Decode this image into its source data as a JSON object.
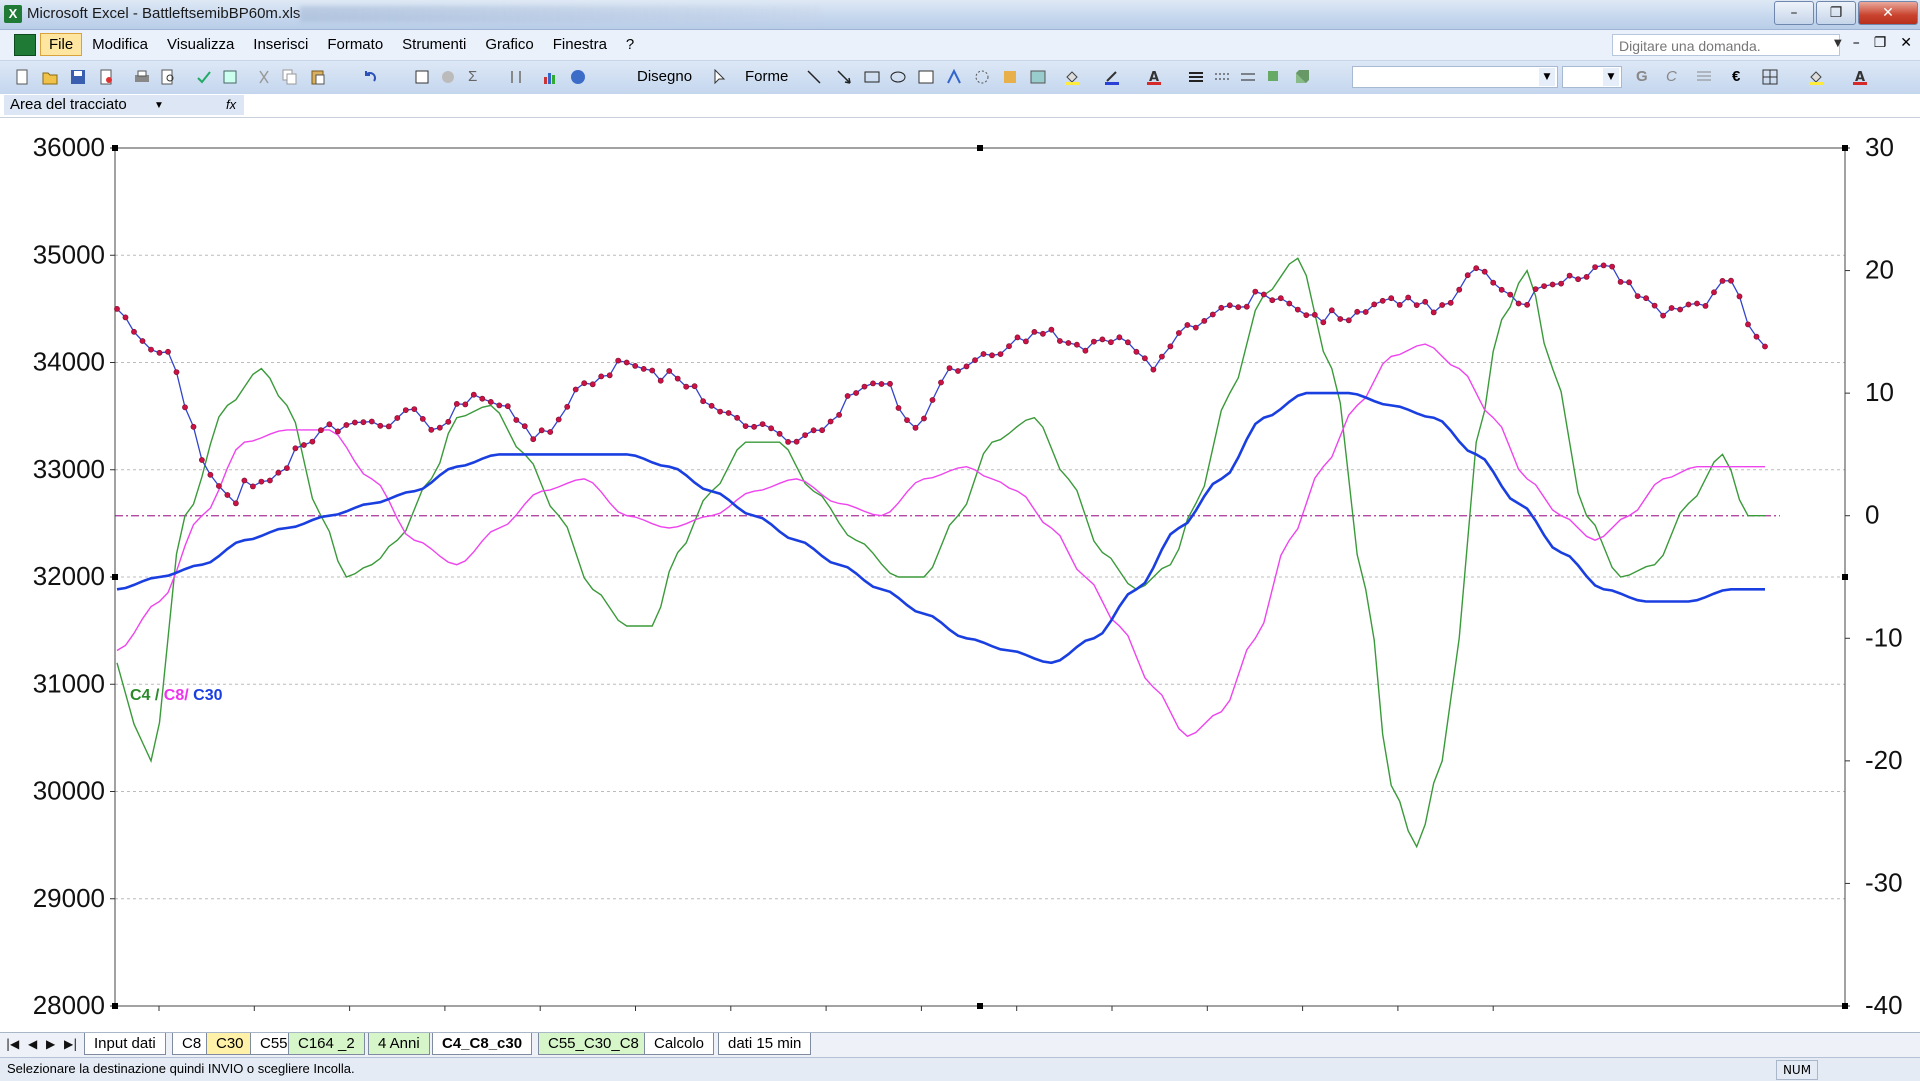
{
  "window": {
    "title": "Microsoft Excel - BattleftsemibBP60m.xls",
    "minimize": "–",
    "restore": "❐",
    "close": "✕"
  },
  "menu": {
    "items": [
      "File",
      "Modifica",
      "Visualizza",
      "Inserisci",
      "Formato",
      "Strumenti",
      "Grafico",
      "Finestra",
      "?"
    ],
    "ask_placeholder": "Digitare una domanda."
  },
  "toolbar": {
    "disegno_label": "Disegno",
    "forme_label": "Forme"
  },
  "namebox": {
    "value": "Area del tracciato",
    "fx": "fx"
  },
  "chart_data": {
    "type": "line",
    "y_left": {
      "range": [
        28000,
        36000
      ],
      "ticks": [
        "36000",
        "35000",
        "34000",
        "33000",
        "32000",
        "31000",
        "30000",
        "29000",
        "28000"
      ]
    },
    "y_right": {
      "range": [
        -40,
        30
      ],
      "ticks": [
        "30",
        "20",
        "10",
        "0",
        "-10",
        "-20",
        "-30",
        "-40"
      ]
    },
    "grid": "horizontal dashed",
    "zero_line": "dash-dot magenta at right-axis 0",
    "legend_label": {
      "c4": "C4",
      "sep1": " / ",
      "c8": "C8/",
      "c30": " C30"
    },
    "colors": {
      "price": "#cc1144",
      "price_line": "#3344cc",
      "c4": "#3a9a3a",
      "c8": "#ee44ee",
      "c30": "#1a3fe0"
    },
    "n_points": 195,
    "series": [
      {
        "name": "Price",
        "axis": "left",
        "keypoints": [
          [
            0,
            34500
          ],
          [
            3,
            34200
          ],
          [
            6,
            34100
          ],
          [
            9,
            33400
          ],
          [
            11,
            32900
          ],
          [
            14,
            32700
          ],
          [
            15,
            32900
          ],
          [
            17,
            32850
          ],
          [
            19,
            32950
          ],
          [
            21,
            33200
          ],
          [
            25,
            33400
          ],
          [
            30,
            33450
          ],
          [
            35,
            33500
          ],
          [
            38,
            33400
          ],
          [
            42,
            33700
          ],
          [
            45,
            33600
          ],
          [
            50,
            33300
          ],
          [
            55,
            33800
          ],
          [
            60,
            34000
          ],
          [
            66,
            33850
          ],
          [
            70,
            33600
          ],
          [
            75,
            33400
          ],
          [
            80,
            33300
          ],
          [
            84,
            33450
          ],
          [
            86,
            33700
          ],
          [
            90,
            33800
          ],
          [
            94,
            33400
          ],
          [
            98,
            33900
          ],
          [
            103,
            34100
          ],
          [
            109,
            34300
          ],
          [
            113,
            34100
          ],
          [
            118,
            34200
          ],
          [
            122,
            34000
          ],
          [
            126,
            34350
          ],
          [
            131,
            34500
          ],
          [
            136,
            34650
          ],
          [
            140,
            34450
          ],
          [
            145,
            34400
          ],
          [
            150,
            34600
          ],
          [
            155,
            34500
          ],
          [
            160,
            34850
          ],
          [
            165,
            34550
          ],
          [
            170,
            34800
          ],
          [
            175,
            34900
          ],
          [
            178,
            34700
          ],
          [
            182,
            34500
          ],
          [
            186,
            34550
          ],
          [
            190,
            34800
          ],
          [
            193,
            34200
          ]
        ]
      },
      {
        "name": "C4",
        "axis": "right",
        "keypoints": [
          [
            0,
            -12
          ],
          [
            2,
            -17
          ],
          [
            4,
            -20
          ],
          [
            8,
            0
          ],
          [
            13,
            9
          ],
          [
            17,
            12
          ],
          [
            20,
            9
          ],
          [
            24,
            0
          ],
          [
            27,
            -5
          ],
          [
            30,
            -4
          ],
          [
            33,
            -2
          ],
          [
            37,
            3
          ],
          [
            40,
            8
          ],
          [
            44,
            9
          ],
          [
            48,
            5
          ],
          [
            52,
            0
          ],
          [
            56,
            -6
          ],
          [
            60,
            -9
          ],
          [
            63,
            -9
          ],
          [
            66,
            -3
          ],
          [
            70,
            2
          ],
          [
            74,
            6
          ],
          [
            78,
            6
          ],
          [
            82,
            2
          ],
          [
            87,
            -2
          ],
          [
            92,
            -5
          ],
          [
            95,
            -5
          ],
          [
            99,
            0
          ],
          [
            103,
            6
          ],
          [
            108,
            8
          ],
          [
            112,
            3
          ],
          [
            116,
            -3
          ],
          [
            120,
            -6
          ],
          [
            124,
            -4
          ],
          [
            127,
            1
          ],
          [
            131,
            10
          ],
          [
            135,
            18
          ],
          [
            139,
            21
          ],
          [
            143,
            12
          ],
          [
            147,
            -6
          ],
          [
            150,
            -22
          ],
          [
            153,
            -27
          ],
          [
            156,
            -20
          ],
          [
            158,
            -10
          ],
          [
            160,
            6
          ],
          [
            163,
            16
          ],
          [
            166,
            20
          ],
          [
            169,
            12
          ],
          [
            173,
            0
          ],
          [
            177,
            -5
          ],
          [
            181,
            -4
          ],
          [
            185,
            1
          ],
          [
            189,
            5
          ],
          [
            192,
            0
          ]
        ]
      },
      {
        "name": "C8",
        "axis": "right",
        "keypoints": [
          [
            0,
            -11
          ],
          [
            5,
            -7
          ],
          [
            10,
            0
          ],
          [
            15,
            6
          ],
          [
            20,
            7
          ],
          [
            25,
            7
          ],
          [
            30,
            3
          ],
          [
            35,
            -2
          ],
          [
            40,
            -4
          ],
          [
            45,
            -1
          ],
          [
            50,
            2
          ],
          [
            55,
            3
          ],
          [
            60,
            0
          ],
          [
            65,
            -1
          ],
          [
            70,
            0
          ],
          [
            75,
            2
          ],
          [
            80,
            3
          ],
          [
            85,
            1
          ],
          [
            90,
            0
          ],
          [
            95,
            3
          ],
          [
            100,
            4
          ],
          [
            103,
            3
          ],
          [
            106,
            2
          ],
          [
            110,
            -1
          ],
          [
            114,
            -5
          ],
          [
            118,
            -9
          ],
          [
            122,
            -14
          ],
          [
            126,
            -18
          ],
          [
            130,
            -16
          ],
          [
            134,
            -10
          ],
          [
            138,
            -2
          ],
          [
            142,
            4
          ],
          [
            146,
            9
          ],
          [
            150,
            13
          ],
          [
            154,
            14
          ],
          [
            158,
            12
          ],
          [
            162,
            8
          ],
          [
            166,
            3
          ],
          [
            170,
            0
          ],
          [
            174,
            -2
          ],
          [
            178,
            0
          ],
          [
            182,
            3
          ],
          [
            186,
            4
          ],
          [
            190,
            4
          ],
          [
            193,
            4
          ]
        ]
      },
      {
        "name": "C30",
        "axis": "right",
        "keypoints": [
          [
            0,
            -6
          ],
          [
            5,
            -5
          ],
          [
            10,
            -4
          ],
          [
            15,
            -2
          ],
          [
            20,
            -1
          ],
          [
            25,
            0
          ],
          [
            30,
            1
          ],
          [
            35,
            2
          ],
          [
            40,
            4
          ],
          [
            45,
            5
          ],
          [
            50,
            5
          ],
          [
            55,
            5
          ],
          [
            60,
            5
          ],
          [
            65,
            4
          ],
          [
            70,
            2
          ],
          [
            75,
            0
          ],
          [
            80,
            -2
          ],
          [
            85,
            -4
          ],
          [
            90,
            -6
          ],
          [
            95,
            -8
          ],
          [
            100,
            -10
          ],
          [
            105,
            -11
          ],
          [
            110,
            -12
          ],
          [
            115,
            -10
          ],
          [
            120,
            -6
          ],
          [
            125,
            -1
          ],
          [
            130,
            3
          ],
          [
            135,
            8
          ],
          [
            140,
            10
          ],
          [
            145,
            10
          ],
          [
            150,
            9
          ],
          [
            155,
            8
          ],
          [
            160,
            5
          ],
          [
            165,
            1
          ],
          [
            170,
            -3
          ],
          [
            175,
            -6
          ],
          [
            180,
            -7
          ],
          [
            185,
            -7
          ],
          [
            190,
            -6
          ],
          [
            193,
            -6
          ]
        ]
      }
    ]
  },
  "tabs": [
    {
      "label": "Input dati",
      "style": "plain"
    },
    {
      "label": "C8",
      "style": "plain"
    },
    {
      "label": "C30",
      "style": "yellow"
    },
    {
      "label": "C55",
      "style": "plain"
    },
    {
      "label": "C164 _2",
      "style": "green"
    },
    {
      "label": "4 Anni",
      "style": "green"
    },
    {
      "label": "C4_C8_c30",
      "style": "active"
    },
    {
      "label": "C55_C30_C8",
      "style": "green"
    },
    {
      "label": "Calcolo",
      "style": "plain"
    },
    {
      "label": "dati 15 min",
      "style": "plain"
    }
  ],
  "status": {
    "message": "Selezionare la destinazione quindi INVIO o scegliere Incolla.",
    "num": "NUM"
  }
}
